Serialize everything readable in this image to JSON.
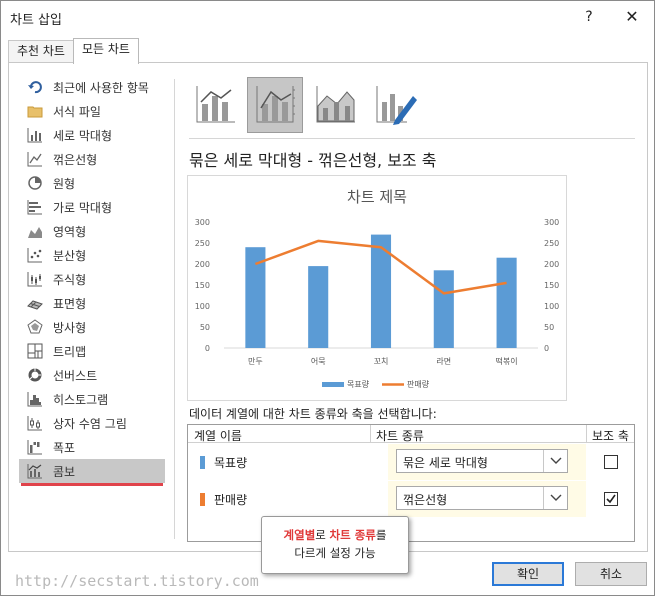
{
  "window": {
    "title": "차트 삽입",
    "help_label": "?",
    "close_label": "✕"
  },
  "tabs": [
    {
      "label": "추천 차트"
    },
    {
      "label": "모든 차트"
    }
  ],
  "sidebar": {
    "items": [
      {
        "label": "최근에 사용한 항목",
        "icon": "undo-icon"
      },
      {
        "label": "서식 파일",
        "icon": "folder-icon"
      },
      {
        "label": "세로 막대형",
        "icon": "column-chart-icon"
      },
      {
        "label": "꺾은선형",
        "icon": "line-chart-icon"
      },
      {
        "label": "원형",
        "icon": "pie-chart-icon"
      },
      {
        "label": "가로 막대형",
        "icon": "bar-chart-icon"
      },
      {
        "label": "영역형",
        "icon": "area-chart-icon"
      },
      {
        "label": "분산형",
        "icon": "scatter-chart-icon"
      },
      {
        "label": "주식형",
        "icon": "stock-chart-icon"
      },
      {
        "label": "표면형",
        "icon": "surface-chart-icon"
      },
      {
        "label": "방사형",
        "icon": "radar-chart-icon"
      },
      {
        "label": "트리맵",
        "icon": "treemap-icon"
      },
      {
        "label": "선버스트",
        "icon": "sunburst-icon"
      },
      {
        "label": "히스토그램",
        "icon": "histogram-icon"
      },
      {
        "label": "상자 수염 그림",
        "icon": "box-whisker-icon"
      },
      {
        "label": "폭포",
        "icon": "waterfall-icon"
      },
      {
        "label": "콤보",
        "icon": "combo-chart-icon",
        "selected": true
      }
    ]
  },
  "subtypes": [
    {
      "name": "clustered-column-line",
      "icon": "combo-column-line-icon"
    },
    {
      "name": "clustered-column-line-secondary",
      "icon": "combo-column-line-secondary-icon",
      "active": true
    },
    {
      "name": "stacked-area-column",
      "icon": "combo-area-column-icon"
    },
    {
      "name": "custom-combination",
      "icon": "combo-custom-icon"
    }
  ],
  "main": {
    "section_title": "묶은 세로 막대형 - 꺾은선형, 보조 축"
  },
  "chart_data": {
    "type": "bar",
    "title": "차트 제목",
    "categories": [
      "만두",
      "어묵",
      "꼬치",
      "라면",
      "떡볶이"
    ],
    "series": [
      {
        "name": "목표량",
        "type": "bar",
        "axis": "primary",
        "color": "#5b9bd5",
        "values": [
          240,
          195,
          270,
          185,
          215
        ]
      },
      {
        "name": "판매량",
        "type": "line",
        "axis": "secondary",
        "color": "#ed7d31",
        "values": [
          200,
          255,
          240,
          130,
          155
        ]
      }
    ],
    "ylim": [
      0,
      300
    ],
    "y2lim": [
      0,
      300
    ],
    "y_ticks": [
      0,
      50,
      100,
      150,
      200,
      250,
      300
    ],
    "y2_ticks": [
      0,
      50,
      100,
      150,
      200,
      250,
      300
    ],
    "legend": "bottom",
    "grid": false
  },
  "series_grid": {
    "caption": "데이터 계열에 대한 차트 종류와 축을 선택합니다:",
    "headers": {
      "name": "계열 이름",
      "type": "차트 종류",
      "axis": "보조 축"
    },
    "rows": [
      {
        "name": "목표량",
        "color": "#5b9bd5",
        "chart_type": "묶은 세로 막대형",
        "secondary_axis": false
      },
      {
        "name": "판매량",
        "color": "#ed7d31",
        "chart_type": "꺾은선형",
        "secondary_axis": true
      }
    ]
  },
  "callout": {
    "part1": "계열별",
    "part2": "로 ",
    "part3": "차트 종류",
    "part4": "를",
    "line2": "다르게 설정 가능"
  },
  "watermark": "http://secstart.tistory.com",
  "buttons": {
    "ok_label": "확인",
    "cancel_label": "취소"
  }
}
